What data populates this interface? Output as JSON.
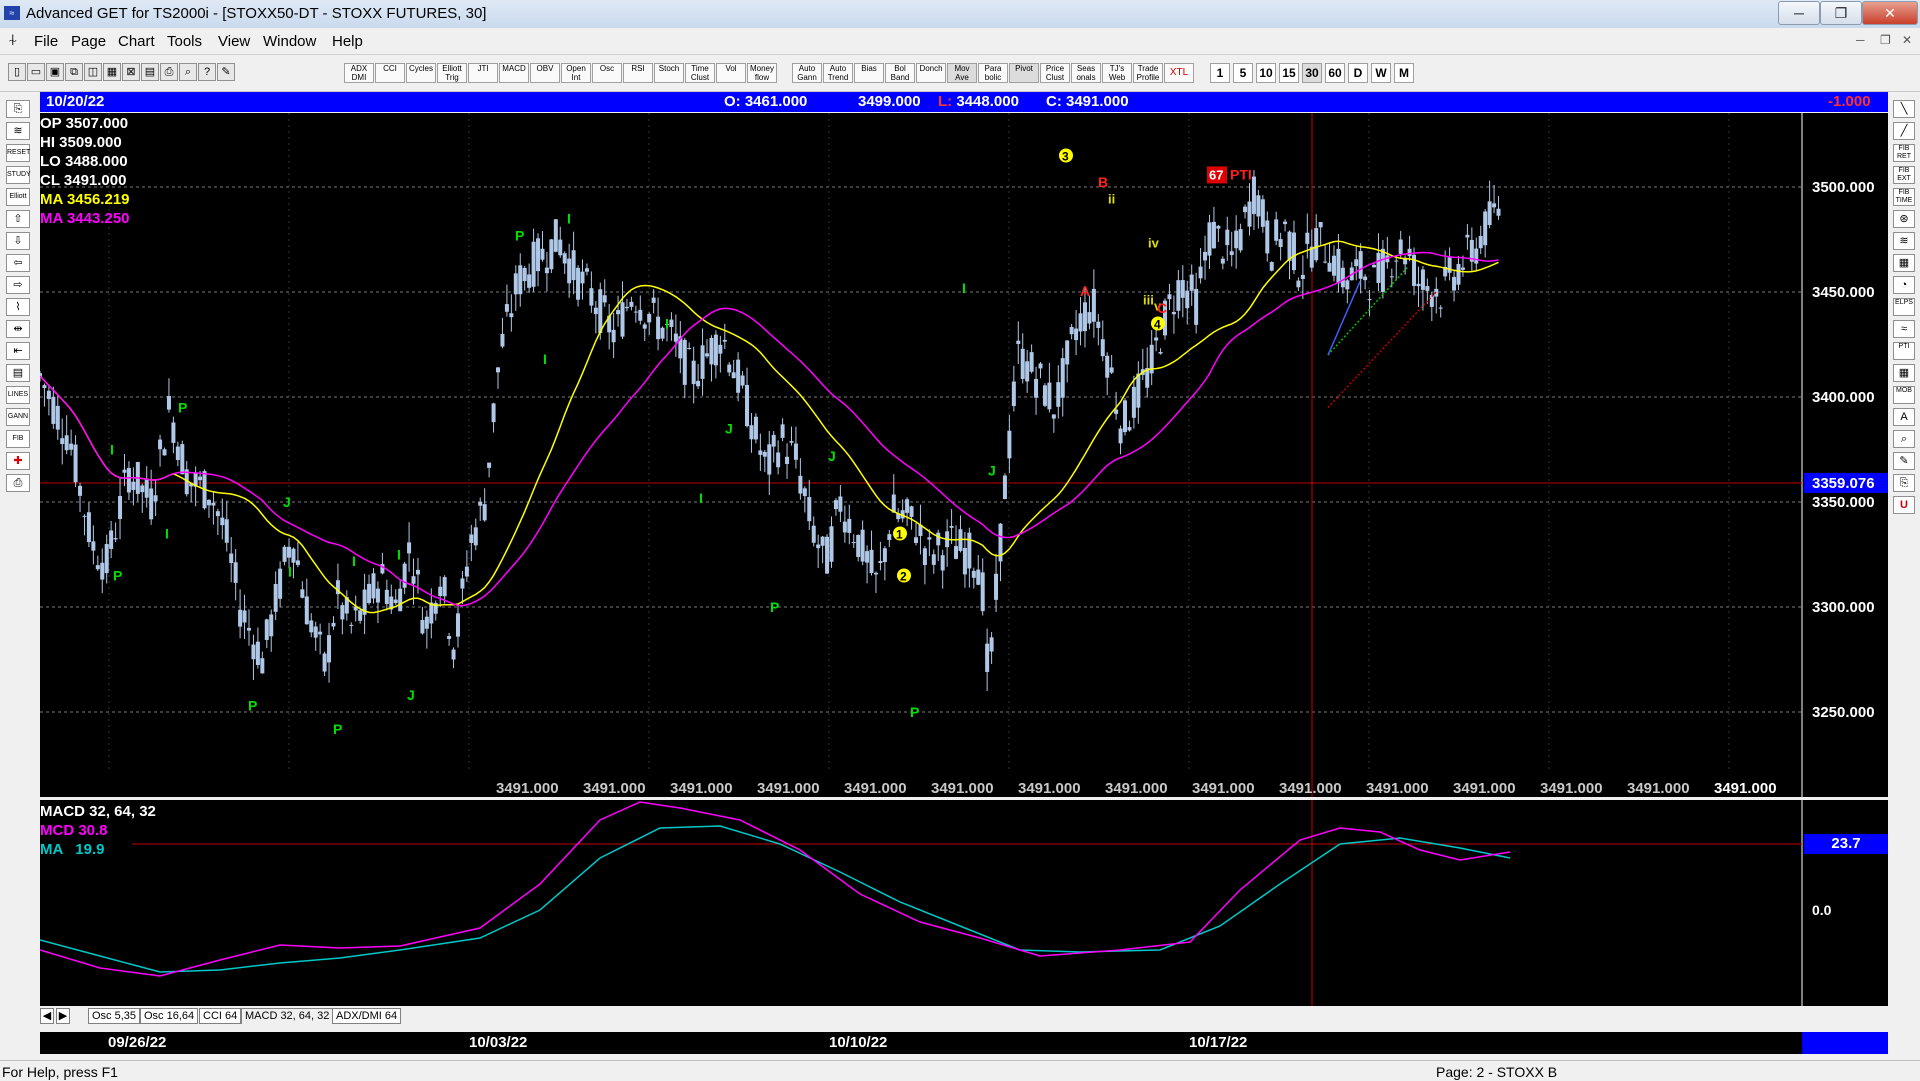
{
  "window": {
    "title": "Advanced GET for TS2000i - [STOXX50-DT - STOXX FUTURES, 30]",
    "minimize": "─",
    "restore": "❐",
    "close": "✕"
  },
  "menu": [
    "File",
    "Page",
    "Chart",
    "Tools",
    "View",
    "Window",
    "Help"
  ],
  "toolbar": {
    "indicators": [
      "ADX DMI",
      "CCI",
      "Cycles",
      "Elliott Trig",
      "JTI",
      "MACD",
      "OBV",
      "Open Int",
      "Osc",
      "RSI",
      "Stoch",
      "Time Clust",
      "Vol",
      "Money flow"
    ],
    "studies": [
      "Auto Gann",
      "Auto Trend",
      "Bias",
      "Bol Band",
      "Donch",
      "Mov Ave",
      "Para bolic",
      "Pivot",
      "Price Clust",
      "Seas onals",
      "TJ's Web",
      "Trade Profile",
      "XTL"
    ],
    "timeframes": [
      "1",
      "5",
      "10",
      "15",
      "30",
      "60",
      "D",
      "W",
      "M"
    ],
    "selected_timeframe": "30"
  },
  "infobar": {
    "date": "10/20/22",
    "open": "O: 3461.000",
    "high": "3499.000",
    "low": "L: 3448.000",
    "close": "C: 3491.000",
    "change": "-1.000"
  },
  "stats": [
    {
      "label": "OP",
      "value": "3507.000",
      "color": "#ffffff"
    },
    {
      "label": "HI",
      "value": "3509.000",
      "color": "#ffffff"
    },
    {
      "label": "LO",
      "value": "3488.000",
      "color": "#ffffff"
    },
    {
      "label": "CL",
      "value": "3491.000",
      "color": "#ffffff"
    },
    {
      "label": "MA",
      "value": "3456.219",
      "color": "#ffff00"
    },
    {
      "label": "MA",
      "value": "3443.250",
      "color": "#ff00ff"
    }
  ],
  "price_axis": [
    "3500.000",
    "3450.000",
    "3400.000",
    "3350.000",
    "3300.000",
    "3250.000"
  ],
  "price_cursor": "3359.076",
  "bottom_values": [
    "3491.000",
    "3491.000",
    "3491.000",
    "3491.000",
    "3491.000",
    "3491.000",
    "3491.000",
    "3491.000",
    "3491.000",
    "3491.000",
    "3491.000",
    "3491.000",
    "3491.000",
    "3491.000",
    "3491.000"
  ],
  "pti": {
    "value": "67",
    "label": "PTI"
  },
  "elliott_labels": {
    "major": [
      "1",
      "2",
      "3",
      "4"
    ],
    "minor": [
      "ii",
      "iii",
      "iv",
      "v"
    ],
    "abc": [
      "A",
      "B",
      "C"
    ]
  },
  "pivot_labels": [
    "P",
    "I",
    "J"
  ],
  "macd": {
    "title": "MACD 32, 64, 32",
    "mcd": "MCD 30.8",
    "ma": "MA   19.9",
    "level": "23.7",
    "zero": "0.0"
  },
  "tabs": [
    "Osc 5,35",
    "Osc 16,64",
    "CCI 64",
    "MACD 32, 64, 32",
    "ADX/DMI 64"
  ],
  "dates": [
    "09/26/22",
    "10/03/22",
    "10/10/22",
    "10/17/22"
  ],
  "status": {
    "help": "For Help, press F1",
    "page": "Page: 2 - STOXX B"
  },
  "colors": {
    "background": "#000000",
    "candle": "#b0c8e8",
    "ma_fast": "#ffff00",
    "ma_slow": "#ff00ff",
    "macd_line": "#ff00ff",
    "signal_line": "#00c8c8",
    "pivot": "#00e000",
    "grid": "#7a7a7a",
    "cursor": "#c00000"
  }
}
